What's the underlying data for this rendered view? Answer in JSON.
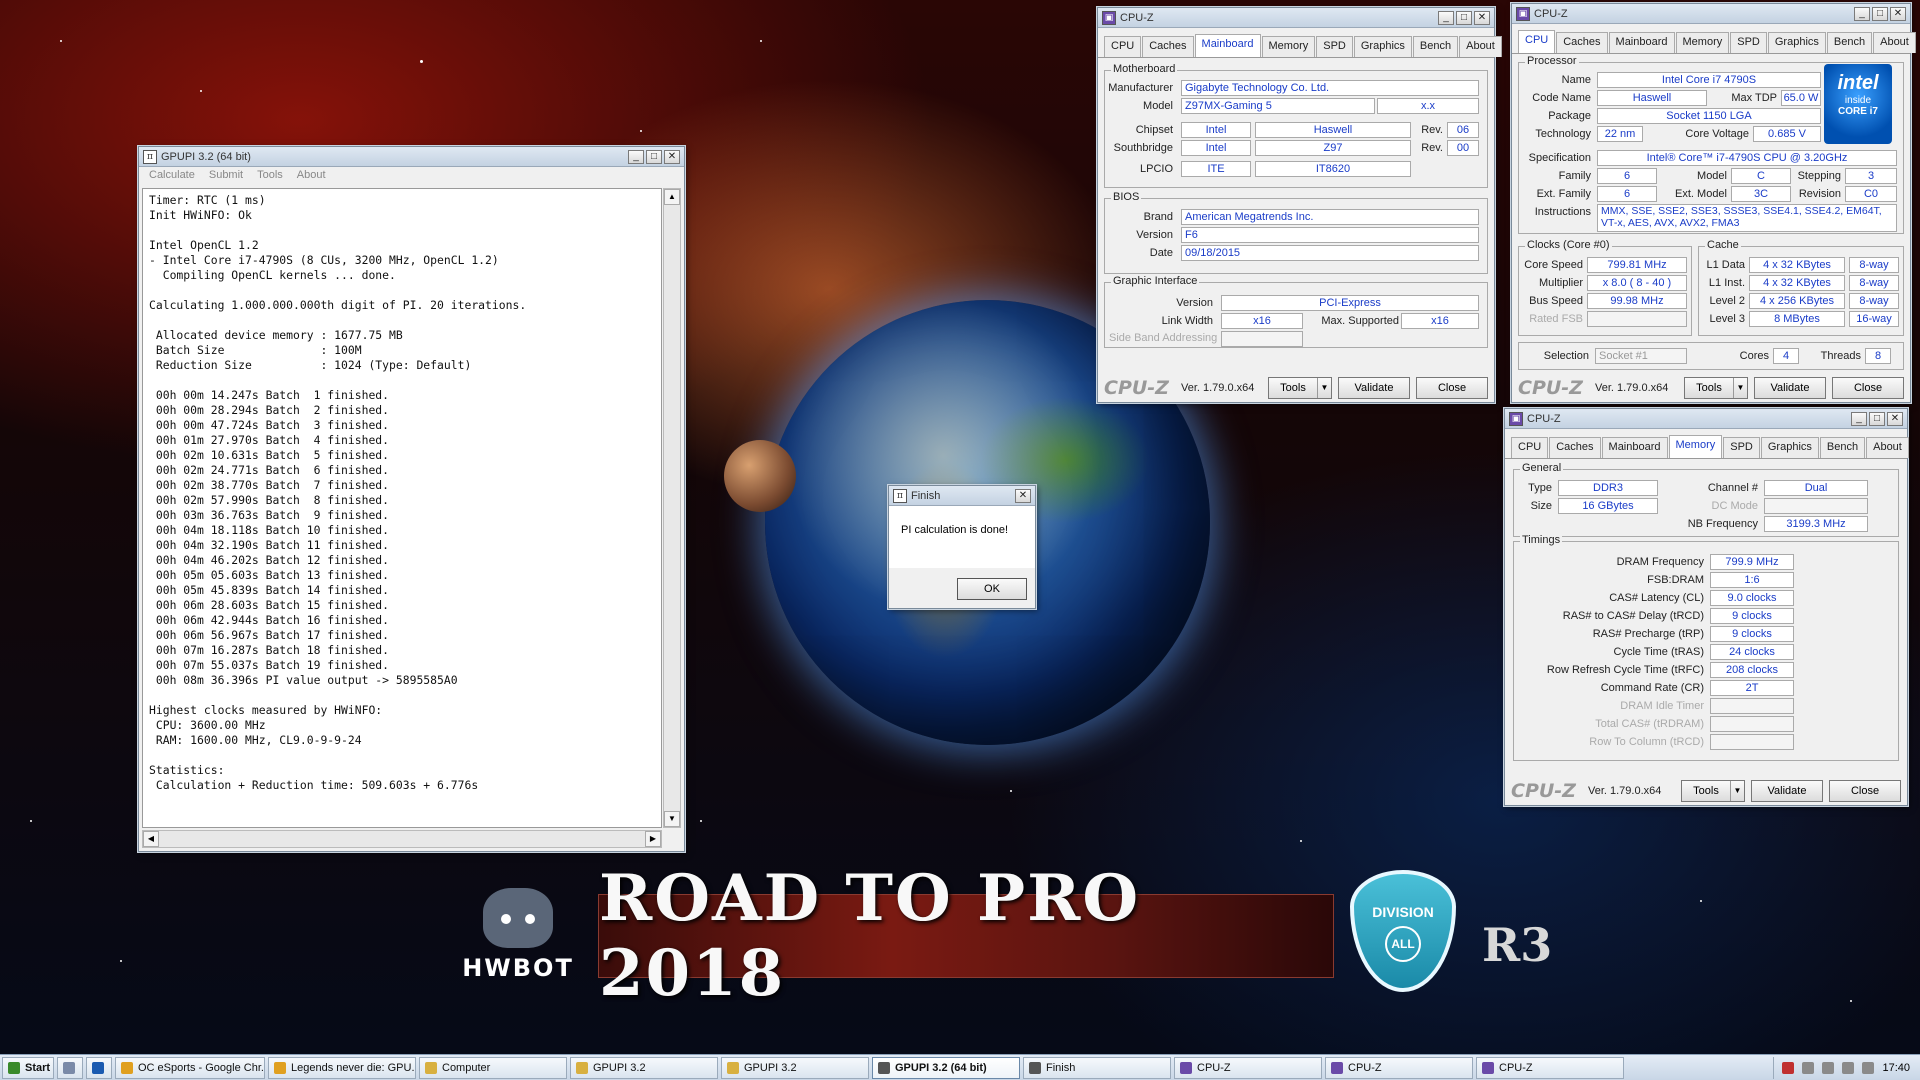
{
  "banner": {
    "text": "ROAD TO PRO 2018",
    "hwbot": "HWBOT",
    "division": "DIVISION",
    "division_sub": "ALL",
    "round": "R3"
  },
  "gpupi": {
    "title": "GPUPI 3.2 (64 bit)",
    "menu": [
      "Calculate",
      "Submit",
      "Tools",
      "About"
    ],
    "log": "Timer: RTC (1 ms)\nInit HWiNFO: Ok\n\nIntel OpenCL 1.2\n- Intel Core i7-4790S (8 CUs, 3200 MHz, OpenCL 1.2)\n  Compiling OpenCL kernels ... done.\n\nCalculating 1.000.000.000th digit of PI. 20 iterations.\n\n Allocated device memory : 1677.75 MB\n Batch Size              : 100M\n Reduction Size          : 1024 (Type: Default)\n\n 00h 00m 14.247s Batch  1 finished.\n 00h 00m 28.294s Batch  2 finished.\n 00h 00m 47.724s Batch  3 finished.\n 00h 01m 27.970s Batch  4 finished.\n 00h 02m 10.631s Batch  5 finished.\n 00h 02m 24.771s Batch  6 finished.\n 00h 02m 38.770s Batch  7 finished.\n 00h 02m 57.990s Batch  8 finished.\n 00h 03m 36.763s Batch  9 finished.\n 00h 04m 18.118s Batch 10 finished.\n 00h 04m 32.190s Batch 11 finished.\n 00h 04m 46.202s Batch 12 finished.\n 00h 05m 05.603s Batch 13 finished.\n 00h 05m 45.839s Batch 14 finished.\n 00h 06m 28.603s Batch 15 finished.\n 00h 06m 42.944s Batch 16 finished.\n 00h 06m 56.967s Batch 17 finished.\n 00h 07m 16.287s Batch 18 finished.\n 00h 07m 55.037s Batch 19 finished.\n 00h 08m 36.396s PI value output -> 5895585A0\n\nHighest clocks measured by HWiNFO:\n CPU: 3600.00 MHz\n RAM: 1600.00 MHz, CL9.0-9-9-24\n\nStatistics:\n Calculation + Reduction time: 509.603s + 6.776s"
  },
  "finish": {
    "title": "Finish",
    "message": "PI calculation is done!",
    "ok": "OK"
  },
  "cpuz_common": {
    "title": "CPU-Z",
    "tabs": [
      "CPU",
      "Caches",
      "Mainboard",
      "Memory",
      "SPD",
      "Graphics",
      "Bench",
      "About"
    ],
    "logo": "CPU-Z",
    "version": "Ver. 1.79.0.x64",
    "tools": "Tools",
    "validate": "Validate",
    "close": "Close"
  },
  "mainboard": {
    "group_motherboard": "Motherboard",
    "manufacturer_label": "Manufacturer",
    "manufacturer": "Gigabyte Technology Co. Ltd.",
    "model_label": "Model",
    "model": "Z97MX-Gaming 5",
    "model_rev": "x.x",
    "chipset_label": "Chipset",
    "chipset_vendor": "Intel",
    "chipset_name": "Haswell",
    "rev_label": "Rev.",
    "chipset_rev": "06",
    "southbridge_label": "Southbridge",
    "sb_vendor": "Intel",
    "sb_name": "Z97",
    "sb_rev": "00",
    "lpcio_label": "LPCIO",
    "lpcio_vendor": "ITE",
    "lpcio_name": "IT8620",
    "group_bios": "BIOS",
    "brand_label": "Brand",
    "brand": "American Megatrends Inc.",
    "version_label": "Version",
    "version": "F6",
    "date_label": "Date",
    "date": "09/18/2015",
    "group_graphic": "Graphic Interface",
    "gi_version_label": "Version",
    "gi_version": "PCI-Express",
    "link_width_label": "Link Width",
    "link_width": "x16",
    "max_supported_label": "Max. Supported",
    "max_supported": "x16",
    "side_band_label": "Side Band Addressing"
  },
  "cpu": {
    "group_processor": "Processor",
    "name_label": "Name",
    "name": "Intel Core i7 4790S",
    "codename_label": "Code Name",
    "codename": "Haswell",
    "maxtdp_label": "Max TDP",
    "maxtdp": "65.0 W",
    "package_label": "Package",
    "package": "Socket 1150 LGA",
    "technology_label": "Technology",
    "technology": "22 nm",
    "corevoltage_label": "Core Voltage",
    "corevoltage": "0.685 V",
    "spec_label": "Specification",
    "spec": "Intel® Core™ i7-4790S CPU @ 3.20GHz",
    "family_label": "Family",
    "family": "6",
    "model_label": "Model",
    "model": "C",
    "stepping_label": "Stepping",
    "stepping": "3",
    "extfamily_label": "Ext. Family",
    "extfamily": "6",
    "extmodel_label": "Ext. Model",
    "extmodel": "3C",
    "revision_label": "Revision",
    "revision": "C0",
    "instructions_label": "Instructions",
    "instructions": "MMX, SSE, SSE2, SSE3, SSSE3, SSE4.1, SSE4.2, EM64T, VT-x, AES, AVX, AVX2, FMA3",
    "intel_logo": {
      "brand": "intel",
      "inside": "inside",
      "core": "CORE i7"
    },
    "group_clocks": "Clocks (Core #0)",
    "corespeed_label": "Core Speed",
    "corespeed": "799.81 MHz",
    "multiplier_label": "Multiplier",
    "multiplier": "x 8.0 ( 8 - 40 )",
    "busspeed_label": "Bus Speed",
    "busspeed": "99.98 MHz",
    "ratedfsb_label": "Rated FSB",
    "group_cache": "Cache",
    "l1d_label": "L1 Data",
    "l1d": "4 x 32 KBytes",
    "l1d_way": "8-way",
    "l1i_label": "L1 Inst.",
    "l1i": "4 x 32 KBytes",
    "l1i_way": "8-way",
    "l2_label": "Level 2",
    "l2": "4 x 256 KBytes",
    "l2_way": "8-way",
    "l3_label": "Level 3",
    "l3": "8 MBytes",
    "l3_way": "16-way",
    "selection_label": "Selection",
    "selection": "Socket #1",
    "cores_label": "Cores",
    "cores": "4",
    "threads_label": "Threads",
    "threads": "8"
  },
  "memory": {
    "group_general": "General",
    "type_label": "Type",
    "type": "DDR3",
    "size_label": "Size",
    "size": "16 GBytes",
    "channel_label": "Channel #",
    "channel": "Dual",
    "dcmode_label": "DC Mode",
    "nbfreq_label": "NB Frequency",
    "nbfreq": "3199.3 MHz",
    "group_timings": "Timings",
    "timings": [
      {
        "label": "DRAM Frequency",
        "value": "799.9 MHz",
        "dim": false
      },
      {
        "label": "FSB:DRAM",
        "value": "1:6",
        "dim": false
      },
      {
        "label": "CAS# Latency (CL)",
        "value": "9.0 clocks",
        "dim": false
      },
      {
        "label": "RAS# to CAS# Delay (tRCD)",
        "value": "9 clocks",
        "dim": false
      },
      {
        "label": "RAS# Precharge (tRP)",
        "value": "9 clocks",
        "dim": false
      },
      {
        "label": "Cycle Time (tRAS)",
        "value": "24 clocks",
        "dim": false
      },
      {
        "label": "Row Refresh Cycle Time (tRFC)",
        "value": "208 clocks",
        "dim": false
      },
      {
        "label": "Command Rate (CR)",
        "value": "2T",
        "dim": false
      },
      {
        "label": "DRAM Idle Timer",
        "value": "",
        "dim": true
      },
      {
        "label": "Total CAS# (tRDRAM)",
        "value": "",
        "dim": true
      },
      {
        "label": "Row To Column (tRCD)",
        "value": "",
        "dim": true
      }
    ]
  },
  "taskbar": {
    "start": "Start",
    "items": [
      {
        "label": "OC eSports - Google Chr...",
        "color": "#e0a020",
        "active": false
      },
      {
        "label": "Legends never die: GPU...",
        "color": "#e0a020",
        "active": false
      },
      {
        "label": "Computer",
        "color": "#d8b040",
        "active": false
      },
      {
        "label": "GPUPI 3.2",
        "color": "#d8b040",
        "active": false
      },
      {
        "label": "GPUPI 3.2",
        "color": "#d8b040",
        "active": false
      },
      {
        "label": "GPUPI 3.2 (64 bit)",
        "color": "#555555",
        "active": true
      },
      {
        "label": "Finish",
        "color": "#555555",
        "active": false
      },
      {
        "label": "CPU-Z",
        "color": "#6a4aa8",
        "active": false
      },
      {
        "label": "CPU-Z",
        "color": "#6a4aa8",
        "active": false
      },
      {
        "label": "CPU-Z",
        "color": "#6a4aa8",
        "active": false
      }
    ],
    "clock": "17:40"
  }
}
